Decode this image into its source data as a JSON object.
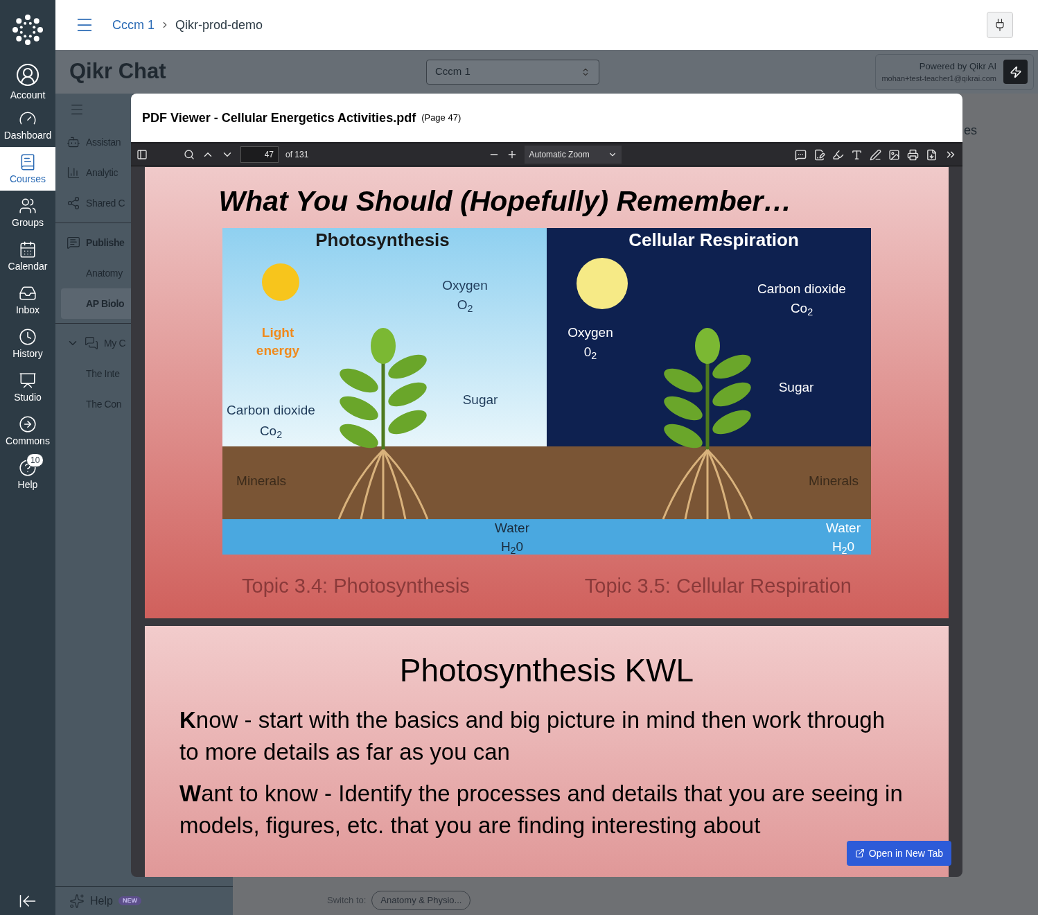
{
  "nav": {
    "items": [
      {
        "label": "Account",
        "kind": "account",
        "selected": false
      },
      {
        "label": "Dashboard",
        "kind": "dashboard",
        "selected": false
      },
      {
        "label": "Courses",
        "kind": "courses",
        "selected": true
      },
      {
        "label": "Groups",
        "kind": "groups",
        "selected": false
      },
      {
        "label": "Calendar",
        "kind": "calendar",
        "selected": false
      },
      {
        "label": "Inbox",
        "kind": "inbox",
        "selected": false
      },
      {
        "label": "History",
        "kind": "history",
        "selected": false
      },
      {
        "label": "Studio",
        "kind": "studio",
        "selected": false
      },
      {
        "label": "Commons",
        "kind": "commons",
        "selected": false
      },
      {
        "label": "Help",
        "kind": "help",
        "selected": false,
        "badge": "10"
      }
    ]
  },
  "breadcrumb": [
    {
      "label": "Cccm 1",
      "kind": "link"
    },
    {
      "label": "Qikr-prod-demo",
      "kind": "current"
    }
  ],
  "app": {
    "title": "Qikr Chat",
    "course_select": {
      "value": "Cccm 1"
    },
    "powered_by": "Powered by Qikr AI",
    "email": "mohan+test-teacher1@qikrai.com",
    "right_fragment": "es"
  },
  "side_panel": {
    "items": [
      {
        "label": "Assistan",
        "kind": "assistant",
        "selected": false
      },
      {
        "label": "Analytic",
        "kind": "analytics",
        "selected": false
      },
      {
        "label": "Shared C",
        "kind": "shared",
        "selected": false
      },
      {
        "label": "Publishe",
        "kind": "published",
        "selected": false
      },
      {
        "label": "Anatomy",
        "kind": "sub",
        "selected": false
      },
      {
        "label": "AP Biolo",
        "kind": "sub",
        "selected": true
      },
      {
        "label": "My C",
        "kind": "mychats",
        "selected": false
      },
      {
        "label": "The Inte",
        "kind": "sub",
        "selected": false
      },
      {
        "label": "The Con",
        "kind": "sub",
        "selected": false
      }
    ],
    "help": {
      "label": "Help",
      "badge": "NEW"
    }
  },
  "switch": {
    "label": "Switch to:",
    "value": "Anatomy & Physio..."
  },
  "pdf_viewer": {
    "title": "PDF Viewer - Cellular Energetics Activities.pdf",
    "page_note": "(Page 47)",
    "toolbar": {
      "page": "47",
      "of": "of 131",
      "zoom": "Automatic Zoom"
    },
    "page1": {
      "heading": "What You Should (Hopefully) Remember…",
      "illustration_labels": [
        "Photosynthesis",
        "Cellular Respiration",
        "Oxygen",
        "O$_{2}$",
        "Light",
        "energy",
        "Carbon dioxide",
        "Co$_{2}$",
        "Sugar",
        "Minerals",
        "Water",
        "H$_{2}$0",
        "Carbon dioxide",
        "Co$_{2}$",
        "Oxygen",
        "0$_{2}$",
        "Sugar",
        "Minerals",
        "Water",
        "H$_{2}$0"
      ],
      "captions": [
        "Topic 3.4: Photosynthesis",
        "Topic 3.5: Cellular Respiration"
      ]
    },
    "page2": {
      "heading": "Photosynthesis KWL",
      "paragraphs": [
        "**K**now - start with the basics and big picture in mind then work through to more details as far as you can",
        "**W**ant to know - Identify the processes and details that you are seeing in models, figures, etc. that you are finding interesting about"
      ]
    },
    "open_button": "Open in New Tab"
  }
}
